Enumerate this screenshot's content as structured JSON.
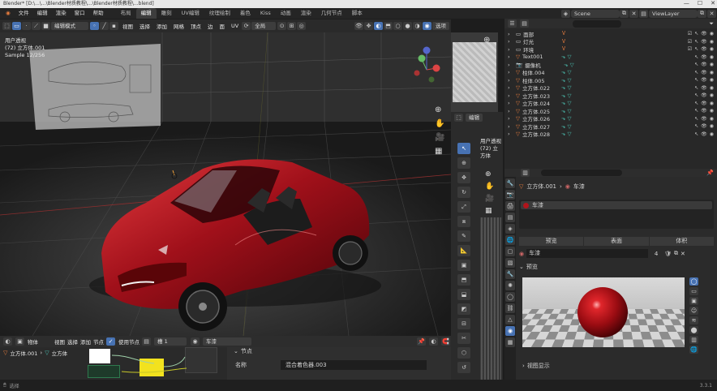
{
  "titlebar": {
    "text": "Blender* [D:\\...\\...\\Blender材质教程\\...\\Blender材质教程\\...blend]",
    "win_controls": [
      "—",
      "☐",
      "✕"
    ]
  },
  "menu": {
    "items": [
      "文件",
      "编辑",
      "渲染",
      "窗口",
      "帮助"
    ]
  },
  "workspaces": {
    "tabs": [
      "布局",
      "编辑",
      "雕刻",
      "UV编辑",
      "纹理绘制",
      "着色",
      "Kiss",
      "动画",
      "渲染",
      "几何节点",
      "脚本"
    ],
    "active_index": 1
  },
  "topright": {
    "scene": "Scene",
    "view_layer": "ViewLayer"
  },
  "vp_header": {
    "mode": "编辑模式",
    "menu": [
      "视图",
      "选择",
      "添加",
      "网格",
      "顶点",
      "边",
      "面",
      "UV"
    ],
    "transform": "全局",
    "shading_label": "选项"
  },
  "viewport_overlay": {
    "line1": "用户透视",
    "line2": "(72) 立方体.001",
    "line3": "Sample 12/256"
  },
  "sidebar": {
    "title": "用户透视",
    "subtitle": "(72) 立方体",
    "tab_label": "编辑"
  },
  "outliner": {
    "rows": [
      {
        "name": "面部",
        "type": "collection"
      },
      {
        "name": "灯光",
        "type": "collection"
      },
      {
        "name": "环境",
        "type": "collection"
      },
      {
        "name": "Text001",
        "type": "object"
      },
      {
        "name": "摄像机",
        "type": "camera"
      },
      {
        "name": "柱体.004",
        "type": "object"
      },
      {
        "name": "柱体.005",
        "type": "object"
      },
      {
        "name": "立方体.022",
        "type": "object"
      },
      {
        "name": "立方体.023",
        "type": "object"
      },
      {
        "name": "立方体.024",
        "type": "object"
      },
      {
        "name": "立方体.025",
        "type": "object"
      },
      {
        "name": "立方体.026",
        "type": "object"
      },
      {
        "name": "立方体.027",
        "type": "object"
      },
      {
        "name": "立方体.028",
        "type": "object"
      }
    ]
  },
  "properties": {
    "breadcrumb_object": "立方体.001",
    "breadcrumb_material": "车漆",
    "slot_name": "车漆",
    "tabs": [
      "预览",
      "表面",
      "体积"
    ],
    "material_field": "车漆",
    "user_count": "4",
    "preview_label": "预览",
    "footer_label": "视图显示"
  },
  "bottom_editor": {
    "header": [
      "物体",
      "视图",
      "选择",
      "添加",
      "节点",
      "使用节点"
    ],
    "slot": "槽 1",
    "material": "车漆",
    "object_name": "立方体.001",
    "mesh_name": "立方体",
    "panel_title": "节点",
    "name_label": "名称",
    "name_value": "混合着色器.003"
  },
  "status": {
    "left": "选择",
    "right": "3.3.1"
  },
  "colors": {
    "accent": "#4772b3",
    "paint": "#c8151d",
    "yellow": "#f2e21e",
    "object_icon": "#e87d3e",
    "mesh_icon": "#4cc2b3"
  }
}
